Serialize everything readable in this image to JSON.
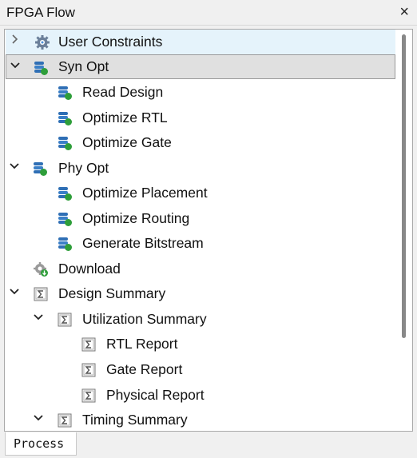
{
  "panel": {
    "title": "FPGA Flow",
    "close_symbol": "×"
  },
  "tree": [
    {
      "label": "User Constraints",
      "icon": "gear-icon",
      "arrow": "›",
      "state": "collapsed",
      "highlight": "hover"
    },
    {
      "label": "Syn Opt",
      "icon": "database-icon",
      "arrow": "⌄",
      "state": "expanded",
      "highlight": "selected"
    },
    {
      "label": "Read Design",
      "icon": "database-icon"
    },
    {
      "label": "Optimize RTL",
      "icon": "database-icon"
    },
    {
      "label": "Optimize Gate",
      "icon": "database-icon"
    },
    {
      "label": "Phy Opt",
      "icon": "database-icon",
      "arrow": "⌄",
      "state": "expanded"
    },
    {
      "label": "Optimize Placement",
      "icon": "database-icon"
    },
    {
      "label": "Optimize Routing",
      "icon": "database-icon"
    },
    {
      "label": "Generate Bitstream",
      "icon": "database-icon"
    },
    {
      "label": "Download",
      "icon": "download-gear-icon"
    },
    {
      "label": "Design Summary",
      "icon": "report-icon",
      "arrow": "⌄",
      "state": "expanded"
    },
    {
      "label": "Utilization Summary",
      "icon": "report-icon",
      "arrow": "⌄",
      "state": "expanded"
    },
    {
      "label": "RTL Report",
      "icon": "report-icon"
    },
    {
      "label": "Gate Report",
      "icon": "report-icon"
    },
    {
      "label": "Physical Report",
      "icon": "report-icon"
    },
    {
      "label": "Timing Summary",
      "icon": "report-icon",
      "arrow": "⌄",
      "state": "expanded"
    }
  ],
  "tabs": [
    {
      "label": "Process"
    }
  ],
  "colors": {
    "hover": "#e5f3fb",
    "selected": "#e0e0e0",
    "accent_green": "#2e9e3a",
    "db_blue": "#2f6fb5"
  }
}
